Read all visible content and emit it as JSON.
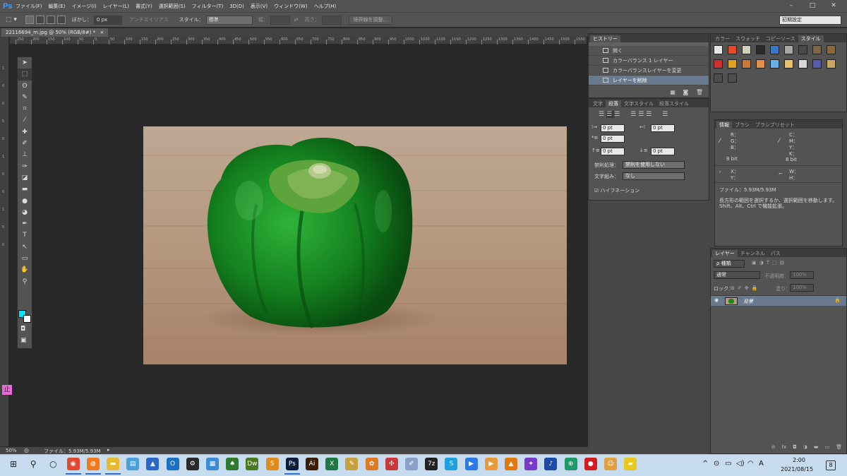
{
  "app": {
    "logo": "Ps"
  },
  "menubar": {
    "items": [
      "ファイル(F)",
      "編集(E)",
      "イメージ(I)",
      "レイヤー(L)",
      "書式(Y)",
      "選択範囲(S)",
      "フィルター(T)",
      "3D(D)",
      "表示(V)",
      "ウィンドウ(W)",
      "ヘルプ(H)"
    ],
    "minimize": "–",
    "maximize": "□",
    "close": "✕"
  },
  "options": {
    "feather_label": "ぼかし：",
    "feather_value": "0 px",
    "antialias_label": "アンチエイリアス",
    "style_label": "スタイル：",
    "style_value": "標準",
    "width_label": "幅：",
    "height_label": "高さ：",
    "refine_button": "境界線を調整...",
    "workspace_value": "初期設定"
  },
  "document": {
    "tab_title": "22116694_m.jpg @ 50% (RGB/8#) *",
    "tab_close": "×",
    "zoom": "50%",
    "file_info": "ファイル：5.93M/5.93M"
  },
  "ruler": {
    "h_ticks": [
      "250",
      "200",
      "150",
      "100",
      "50",
      "0",
      "50",
      "100",
      "150",
      "200",
      "250",
      "300",
      "350",
      "400",
      "450",
      "500",
      "550",
      "600",
      "650",
      "700",
      "750",
      "800",
      "850",
      "900",
      "950",
      "1000",
      "1050",
      "1100",
      "1150",
      "1200",
      "1250",
      "1300",
      "1350",
      "1400",
      "1450",
      "1500",
      "1550",
      "1600"
    ],
    "v_ticks": [
      "1",
      "0",
      "0",
      "5",
      "0",
      "1",
      "0",
      "0",
      "1",
      "5",
      "0"
    ]
  },
  "toolbar": {
    "tools": [
      "move-tool",
      "marquee-tool",
      "lasso-tool",
      "quick-select-tool",
      "crop-tool",
      "eyedropper-tool",
      "healing-brush-tool",
      "brush-tool",
      "clone-stamp-tool",
      "history-brush-tool",
      "eraser-tool",
      "gradient-tool",
      "blur-tool",
      "dodge-tool",
      "pen-tool",
      "type-tool",
      "path-select-tool",
      "rectangle-tool",
      "hand-tool",
      "zoom-tool"
    ],
    "glyphs": [
      "➤",
      "⬚",
      "ʘ",
      "✎",
      "⌗",
      "⁄",
      "✚",
      "✐",
      "⊥",
      "✑",
      "◪",
      "▬",
      "●",
      "◕",
      "✒",
      "T",
      "↖",
      "▭",
      "✋",
      "⚲"
    ],
    "fg_color": "#00e5ff",
    "bg_color": "#ffffff",
    "extra": [
      "◘",
      "▣"
    ]
  },
  "ime": {
    "label": "止"
  },
  "history": {
    "tab": "ヒストリー",
    "items": [
      "開く",
      "カラーバランス 1 レイヤー",
      "カラーバランスレイヤーを変更",
      "レイヤーを削除"
    ],
    "selected": 3
  },
  "color_panel": {
    "tabs": [
      "カラー",
      "スウォッチ",
      "コピーソース",
      "スタイル"
    ],
    "active": 3,
    "swatches": [
      "#e8e8e8",
      "#e84a2a",
      "#cfcfbc",
      "#2a2a2a",
      "#3a78c8",
      "#a8a8a8",
      "#4a4a4a",
      "#7a6648",
      "#8a6a3a",
      "#d03030",
      "#e0a020",
      "#c87838",
      "#e09048",
      "#6ab0e8",
      "#e8c070",
      "#d8d8d8",
      "#5a5aa8",
      "#c8a860",
      "#4e4e4e",
      "#4e4e4e"
    ]
  },
  "paragraph": {
    "tabs": [
      "文字",
      "段落",
      "文字スタイル",
      "段落スタイル"
    ],
    "active": 1,
    "indent_left": "0 pt",
    "indent_right": "0 pt",
    "indent_first": "0 pt",
    "space_before": "0 pt",
    "space_after": "0 pt",
    "kinsoku_label": "禁則処理：",
    "kinsoku_value": "禁則を使用しない",
    "mojikumi_label": "文字組み：",
    "mojikumi_value": "なし",
    "hyphenation": "ハイフネーション"
  },
  "info": {
    "tabs": [
      "情報",
      "ブラシ",
      "ブラシプリセット"
    ],
    "active": 0,
    "rgb": [
      "R：",
      "G：",
      "B："
    ],
    "cmyk": [
      "C：",
      "M：",
      "Y：",
      "K："
    ],
    "bits_left": "8 bit",
    "bits_right": "8 bit",
    "xy": [
      "X：",
      "Y："
    ],
    "wh": [
      "W：",
      "H："
    ],
    "file": "ファイル：5.93M/5.93M",
    "hint": "長方形の範囲を選択するか、選択範囲を移動します。Shift、Alt、Ctrl で機能拡張。"
  },
  "layers": {
    "tabs": [
      "レイヤー",
      "チャンネル",
      "パス"
    ],
    "active": 0,
    "kind_label": "ρ 種類",
    "blend": "通常",
    "opacity_label": "不透明度：",
    "opacity_value": "100%",
    "lock_label": "ロック：",
    "fill_label": "塗り：",
    "fill_value": "100%",
    "layer_name": "背景",
    "footer_icons": [
      "⊖",
      "fx",
      "◘",
      "◑",
      "▬",
      "▭",
      "🗑"
    ]
  },
  "taskbar": {
    "apps": [
      {
        "name": "start-icon",
        "glyph": "⊞",
        "color": "#1e1e1e"
      },
      {
        "name": "search-icon",
        "glyph": "⚲",
        "color": "#1e1e1e"
      },
      {
        "name": "cortana-icon",
        "glyph": "○",
        "color": "#1e1e1e"
      },
      {
        "name": "chrome-icon",
        "glyph": "◉",
        "color": "#e04a32"
      },
      {
        "name": "firefox-icon",
        "glyph": "◍",
        "color": "#f07a20"
      },
      {
        "name": "explorer-icon",
        "glyph": "▬",
        "color": "#e8b830"
      },
      {
        "name": "files-icon",
        "glyph": "▤",
        "color": "#4aa0d8"
      },
      {
        "name": "photos-icon",
        "glyph": "▲",
        "color": "#2a68c8"
      },
      {
        "name": "outlook-icon",
        "glyph": "O",
        "color": "#1a70c8"
      },
      {
        "name": "settings-icon",
        "glyph": "⚙",
        "color": "#2a2a2a"
      },
      {
        "name": "news-icon",
        "glyph": "▦",
        "color": "#3a8ad8"
      },
      {
        "name": "game-icon",
        "glyph": "♠",
        "color": "#2e7a2e"
      },
      {
        "name": "dreamweaver-icon",
        "glyph": "Dw",
        "color": "#4a7a1e"
      },
      {
        "name": "sublime-icon",
        "glyph": "S",
        "color": "#e08a20"
      },
      {
        "name": "photoshop-icon",
        "glyph": "Ps",
        "color": "#0a1e3c"
      },
      {
        "name": "illustrator-icon",
        "glyph": "Ai",
        "color": "#3a1e06"
      },
      {
        "name": "excel-icon",
        "glyph": "X",
        "color": "#1e7a42"
      },
      {
        "name": "paint-icon",
        "glyph": "✎",
        "color": "#c8a040"
      },
      {
        "name": "butterfly-icon",
        "glyph": "✿",
        "color": "#e07a20"
      },
      {
        "name": "network-icon",
        "glyph": "✣",
        "color": "#c83a3a"
      },
      {
        "name": "brush-icon",
        "glyph": "✐",
        "color": "#8aa0c8"
      },
      {
        "name": "7zip-icon",
        "glyph": "7z",
        "color": "#222222"
      },
      {
        "name": "skype-icon",
        "glyph": "S",
        "color": "#1ea0e0"
      },
      {
        "name": "zoom-icon",
        "glyph": "▶",
        "color": "#2a7ae8"
      },
      {
        "name": "player-icon",
        "glyph": "▶",
        "color": "#e89a3a"
      },
      {
        "name": "vlc-icon",
        "glyph": "▲",
        "color": "#e07a10"
      },
      {
        "name": "rabbit-icon",
        "glyph": "✦",
        "color": "#7a3ac8"
      },
      {
        "name": "music-icon",
        "glyph": "♪",
        "color": "#1e4aa8"
      },
      {
        "name": "globe-icon",
        "glyph": "⊕",
        "color": "#1e9a6a"
      },
      {
        "name": "record-icon",
        "glyph": "●",
        "color": "#d01e1e"
      },
      {
        "name": "cat-icon",
        "glyph": "☺",
        "color": "#e0a040"
      },
      {
        "name": "notes-icon",
        "glyph": "▰",
        "color": "#e8c81e"
      }
    ],
    "tray": [
      "^",
      "⊙",
      "▭",
      "◁)",
      "◠",
      "A"
    ],
    "time": "2:00",
    "date": "2021/08/15",
    "notification_count": "8"
  }
}
